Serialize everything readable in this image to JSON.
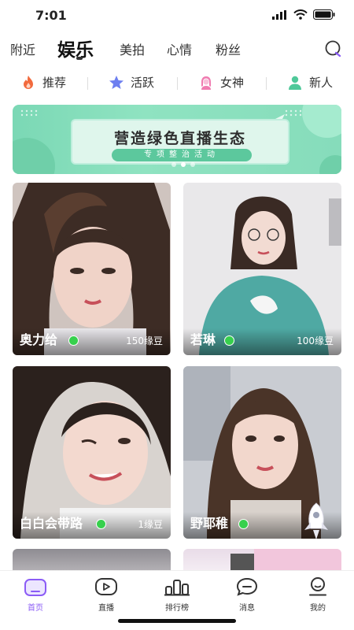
{
  "status_bar": {
    "time": "7:01"
  },
  "top_tabs": [
    {
      "label": "附近",
      "active": false
    },
    {
      "label": "娱乐",
      "active": true
    },
    {
      "label": "美拍",
      "active": false
    },
    {
      "label": "心情",
      "active": false
    },
    {
      "label": "粉丝",
      "active": false
    }
  ],
  "categories": [
    {
      "label": "推荐",
      "icon": "flame-icon"
    },
    {
      "label": "活跃",
      "icon": "star-icon"
    },
    {
      "label": "女神",
      "icon": "goddess-icon"
    },
    {
      "label": "新人",
      "icon": "user-icon"
    }
  ],
  "banner": {
    "headline": "营造绿色直播生态",
    "subline": "专项整治活动",
    "slide_count": 3,
    "active_slide": 2
  },
  "cards": [
    {
      "name": "奥力给",
      "price": "150缘豆",
      "online": true
    },
    {
      "name": "若琳",
      "price": "100缘豆",
      "online": true
    },
    {
      "name": "白白会带路",
      "price": "1缘豆",
      "online": true
    },
    {
      "name": "野耶稚",
      "price": "",
      "online": true
    }
  ],
  "bottom_nav": [
    {
      "label": "首页",
      "icon": "home-icon",
      "active": true
    },
    {
      "label": "直播",
      "icon": "live-icon",
      "active": false
    },
    {
      "label": "排行榜",
      "icon": "ranking-icon",
      "active": false
    },
    {
      "label": "消息",
      "icon": "message-icon",
      "active": false
    },
    {
      "label": "我的",
      "icon": "profile-icon",
      "active": false
    }
  ],
  "colors": {
    "accent": "#8b5cf6",
    "online": "#37d04d",
    "banner_green": "#7bd8b5"
  }
}
